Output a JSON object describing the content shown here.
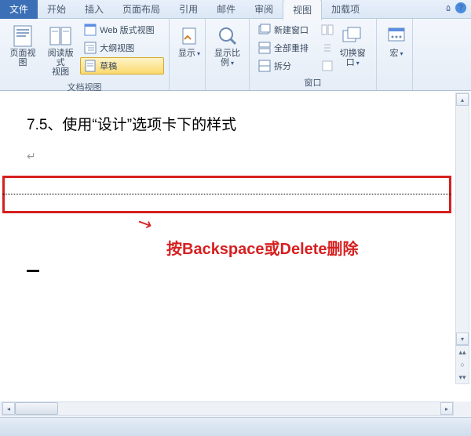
{
  "tabs": {
    "file": "文件",
    "items": [
      "开始",
      "插入",
      "页面布局",
      "引用",
      "邮件",
      "审阅",
      "视图",
      "加载项"
    ],
    "active_index": 6
  },
  "ribbon": {
    "group1": {
      "label": "文档视图",
      "page_view": "页面视图",
      "read_view": "阅读版式\n视图",
      "web_view": "Web 版式视图",
      "outline": "大纲视图",
      "draft": "草稿"
    },
    "group2": {
      "show": "显示"
    },
    "group3": {
      "zoom": "显示比例"
    },
    "group4": {
      "label": "窗口",
      "new_window": "新建窗口",
      "arrange_all": "全部重排",
      "split": "拆分",
      "switch": "切换窗口"
    },
    "group5": {
      "macros": "宏"
    }
  },
  "document": {
    "heading": "7.5、使用“设计”选项卡下的样式",
    "annotation": "按Backspace或Delete删除"
  }
}
